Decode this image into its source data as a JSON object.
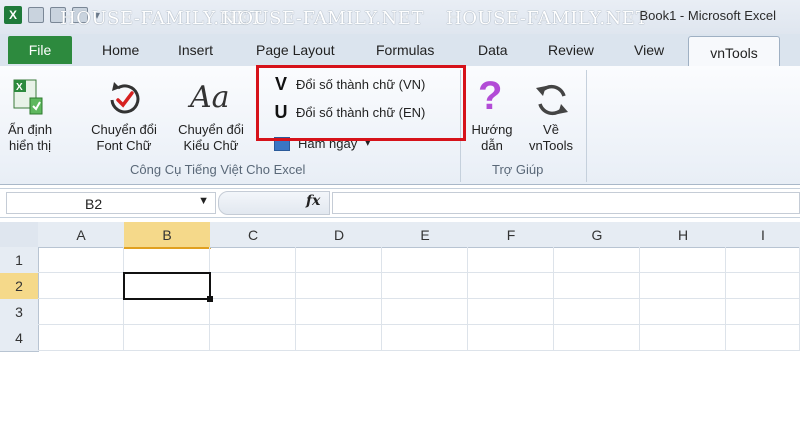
{
  "window": {
    "title": "Book1 - Microsoft Excel",
    "watermark": "HOUSE-FAMILY.NET"
  },
  "tabs": {
    "file": "File",
    "items": [
      "Home",
      "Insert",
      "Page Layout",
      "Formulas",
      "Data",
      "Review",
      "View"
    ],
    "active": "vnTools"
  },
  "ribbon": {
    "an_dinh_line1": "Ẩn định",
    "an_dinh_line2": "hiển thị",
    "chuyen_font_line1": "Chuyển đổi",
    "chuyen_font_line2": "Font Chữ",
    "chuyen_kieu_line1": "Chuyển đổi",
    "chuyen_kieu_line2": "Kiểu Chữ",
    "doi_so_vn": "Đổi số thành chữ (VN)",
    "doi_so_en": "Đổi số thành chữ (EN)",
    "doi_so_vn_glyph": "V",
    "doi_so_en_glyph": "U",
    "ham_ngay": "Hàm ngày",
    "group1_label": "Công Cụ Tiếng Việt Cho Excel",
    "huong_dan_line1": "Hướng",
    "huong_dan_line2": "dẫn",
    "ve_line1": "Về",
    "ve_line2": "vnTools",
    "group2_label": "Trợ Giúp"
  },
  "formula_bar": {
    "name_box": "B2",
    "fx": "fx",
    "formula": ""
  },
  "sheet": {
    "columns": [
      "A",
      "B",
      "C",
      "D",
      "E",
      "F",
      "G",
      "H",
      "I"
    ],
    "rows": [
      "1",
      "2",
      "3",
      "4"
    ],
    "selected_cell": "B2"
  },
  "colors": {
    "file_tab": "#2d8a3e",
    "highlight_border": "#d6121a",
    "selected_header": "#f5d98a"
  }
}
